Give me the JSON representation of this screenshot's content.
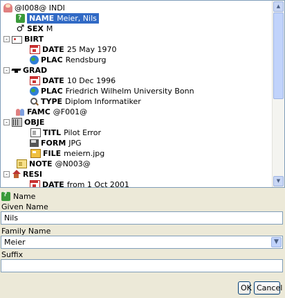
{
  "tree": {
    "rows": [
      {
        "expander": "",
        "icon": "person-icon",
        "tag": "",
        "value": "@I008@ INDI",
        "level": 0
      },
      {
        "expander": "",
        "icon": "name-icon",
        "tag": "NAME",
        "value": "Meier, Nils",
        "level": 1,
        "selected": true
      },
      {
        "expander": "",
        "icon": "male-icon",
        "tag": "SEX",
        "value": "M",
        "level": 1
      },
      {
        "expander": "⊟",
        "icon": "birth-icon",
        "tag": "BIRT",
        "value": "",
        "level": 0
      },
      {
        "expander": "",
        "icon": "date-icon",
        "tag": "DATE",
        "value": "25 May 1970",
        "level": 2
      },
      {
        "expander": "",
        "icon": "globe-icon",
        "tag": "PLAC",
        "value": "Rendsburg",
        "level": 2
      },
      {
        "expander": "⊟",
        "icon": "graduation-icon",
        "tag": "GRAD",
        "value": "",
        "level": 0
      },
      {
        "expander": "",
        "icon": "date-icon",
        "tag": "DATE",
        "value": "10 Dec 1996",
        "level": 2
      },
      {
        "expander": "",
        "icon": "globe-icon",
        "tag": "PLAC",
        "value": "Friedrich Wilhelm University Bonn",
        "level": 2
      },
      {
        "expander": "",
        "icon": "magnifier-icon",
        "tag": "TYPE",
        "value": "Diplom Informatiker",
        "level": 2
      },
      {
        "expander": "",
        "icon": "family-icon",
        "tag": "FAMC",
        "value": "@F001@",
        "level": 1
      },
      {
        "expander": "⊟",
        "icon": "media-icon",
        "tag": "OBJE",
        "value": "",
        "level": 0
      },
      {
        "expander": "",
        "icon": "title-icon",
        "tag": "TITL",
        "value": "Pilot Error",
        "level": 2
      },
      {
        "expander": "",
        "icon": "format-icon",
        "tag": "FORM",
        "value": "JPG",
        "level": 2
      },
      {
        "expander": "",
        "icon": "file-icon",
        "tag": "FILE",
        "value": "meiern.jpg",
        "level": 2
      },
      {
        "expander": "",
        "icon": "note-icon",
        "tag": "NOTE",
        "value": "@N003@",
        "level": 1
      },
      {
        "expander": "⊟",
        "icon": "house-icon",
        "tag": "RESI",
        "value": "",
        "level": 0
      },
      {
        "expander": "",
        "icon": "date-icon",
        "tag": "DATE",
        "value": "from 1 Oct 2001",
        "level": 2
      }
    ]
  },
  "editor": {
    "header": "Name",
    "given_label": "Given Name",
    "given_value": "Nils",
    "family_label": "Family Name",
    "family_value": "Meier",
    "suffix_label": "Suffix",
    "suffix_value": "",
    "ok_label": "OK",
    "cancel_label": "Cancel"
  },
  "colors": {
    "selection": "#316ac5",
    "panel_bg": "#ece9d8",
    "field_border": "#7f9db9"
  }
}
